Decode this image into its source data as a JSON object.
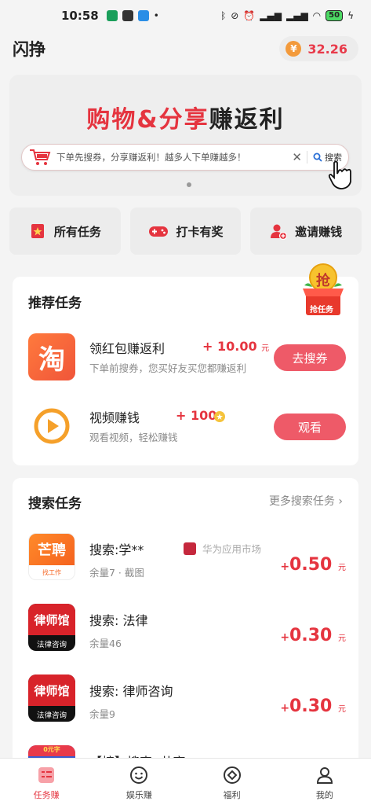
{
  "status_bar": {
    "time": "10:58",
    "battery": "50"
  },
  "header": {
    "title": "闪挣",
    "currency_symbol": "¥",
    "balance": "32.26"
  },
  "banner": {
    "title_part1": "购物",
    "title_amp": "&",
    "title_part2": "分享",
    "title_part3": "赚返利",
    "search_placeholder": "下单先搜券，分享赚返利！越多人下单赚越多！",
    "search_clear": "✕",
    "search_button": "搜索"
  },
  "quick_actions": [
    {
      "label": "所有任务",
      "icon": "star-bookmark-icon"
    },
    {
      "label": "打卡有奖",
      "icon": "gamepad-icon"
    },
    {
      "label": "邀请赚钱",
      "icon": "add-user-icon"
    }
  ],
  "recommended": {
    "title": "推荐任务",
    "badge_label": "抢任务",
    "badge_char": "抢",
    "tasks": [
      {
        "name": "领红包赚返利",
        "reward_prefix": "+",
        "reward": "10.00",
        "reward_unit": "元",
        "desc": "下单前搜券，您买好友买您都赚返利",
        "button": "去搜券",
        "icon": "taobao-icon",
        "icon_text": "淘"
      },
      {
        "name": "视频赚钱",
        "reward_prefix": "+",
        "reward": "100",
        "reward_unit": "",
        "desc": "观看视频，轻松赚钱",
        "button": "观看",
        "icon": "video-play-icon"
      }
    ]
  },
  "search_tasks": {
    "title": "搜索任务",
    "more": "更多搜索任务",
    "items": [
      {
        "name": "搜索:学**",
        "remaining": "余量7 · 截图",
        "store": "华为应用市场",
        "reward_prefix": "+",
        "reward": "0.50",
        "unit": "元",
        "logo_top": "芒聘",
        "logo_bottom": "找工作"
      },
      {
        "name": "搜索: 法律",
        "remaining": "余量46",
        "reward_prefix": "+",
        "reward": "0.30",
        "unit": "元",
        "logo_top": "律师馆",
        "logo_bottom": "法律咨询"
      },
      {
        "name": "搜索: 律师咨询",
        "remaining": "余量9",
        "reward_prefix": "+",
        "reward": "0.30",
        "unit": "元",
        "logo_top": "律师馆",
        "logo_bottom": "法律咨询"
      },
      {
        "name": "【榜】搜索: 共享",
        "logo_top": "0元字"
      }
    ]
  },
  "tabs": [
    {
      "label": "任务赚",
      "icon": "task-list-icon",
      "active": true
    },
    {
      "label": "娱乐赚",
      "icon": "smiley-icon",
      "active": false
    },
    {
      "label": "福利",
      "icon": "diamond-icon",
      "active": false
    },
    {
      "label": "我的",
      "icon": "user-icon",
      "active": false
    }
  ],
  "colors": {
    "accent": "#e5343f",
    "button": "#ee5a68",
    "coin": "#f39a3b"
  }
}
